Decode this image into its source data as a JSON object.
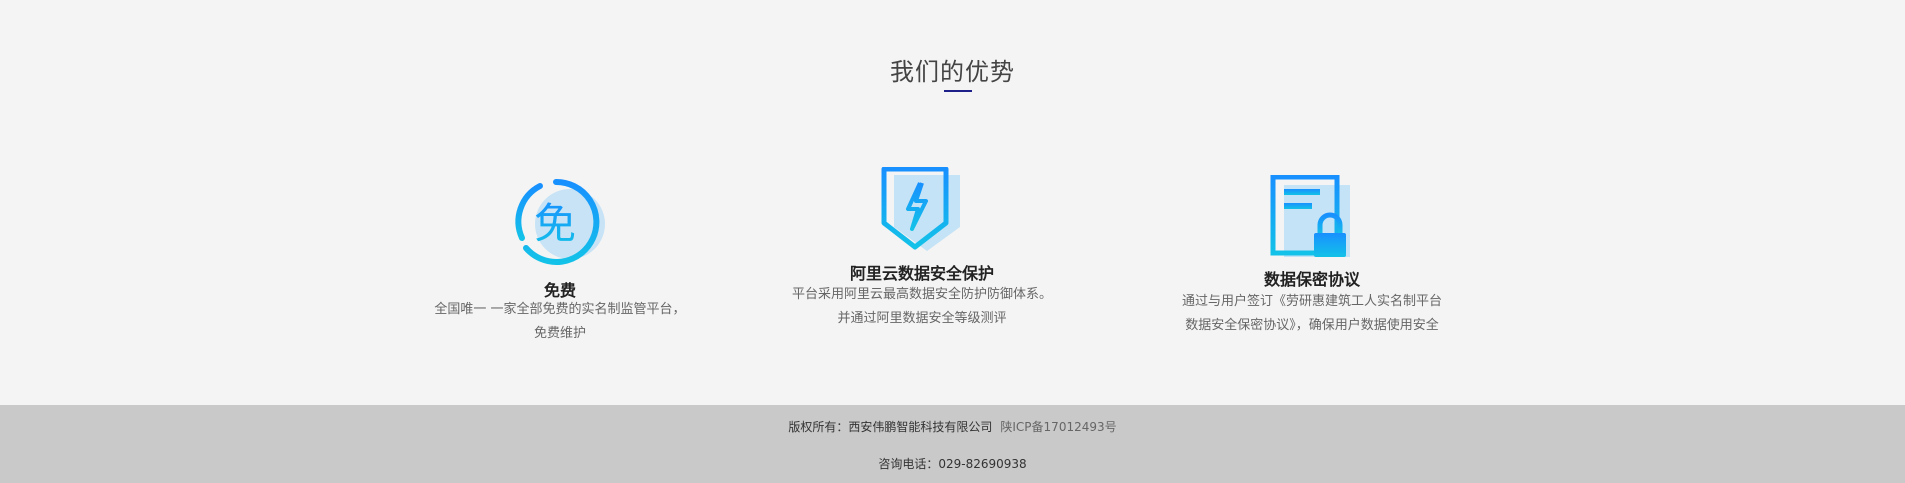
{
  "section": {
    "title": "我们的优势",
    "features": [
      {
        "icon": "free-icon",
        "glyph": "免",
        "title": "免费",
        "desc": "全国唯一 一家全部免费的实名制监管平台，免费维护"
      },
      {
        "icon": "shield-lightning-icon",
        "title": "阿里云数据安全保护",
        "desc": "平台采用阿里云最高数据安全防护防御体系。并通过阿里数据安全等级测评"
      },
      {
        "icon": "document-lock-icon",
        "title": "数据保密协议",
        "desc": "通过与用户签订《劳研惠建筑工人实名制平台数据安全保密协议》，确保用户数据使用安全"
      }
    ]
  },
  "footer": {
    "copyright": "版权所有：西安伟鹏智能科技有限公司",
    "icp": "陕ICP备17012493号",
    "phone": "咨询电话：029-82690938"
  },
  "colors": {
    "accent": "#1d2088",
    "icon_blue": "#1890ff",
    "icon_cyan": "#13c2e8",
    "footer_bg": "#c9c9c9"
  }
}
